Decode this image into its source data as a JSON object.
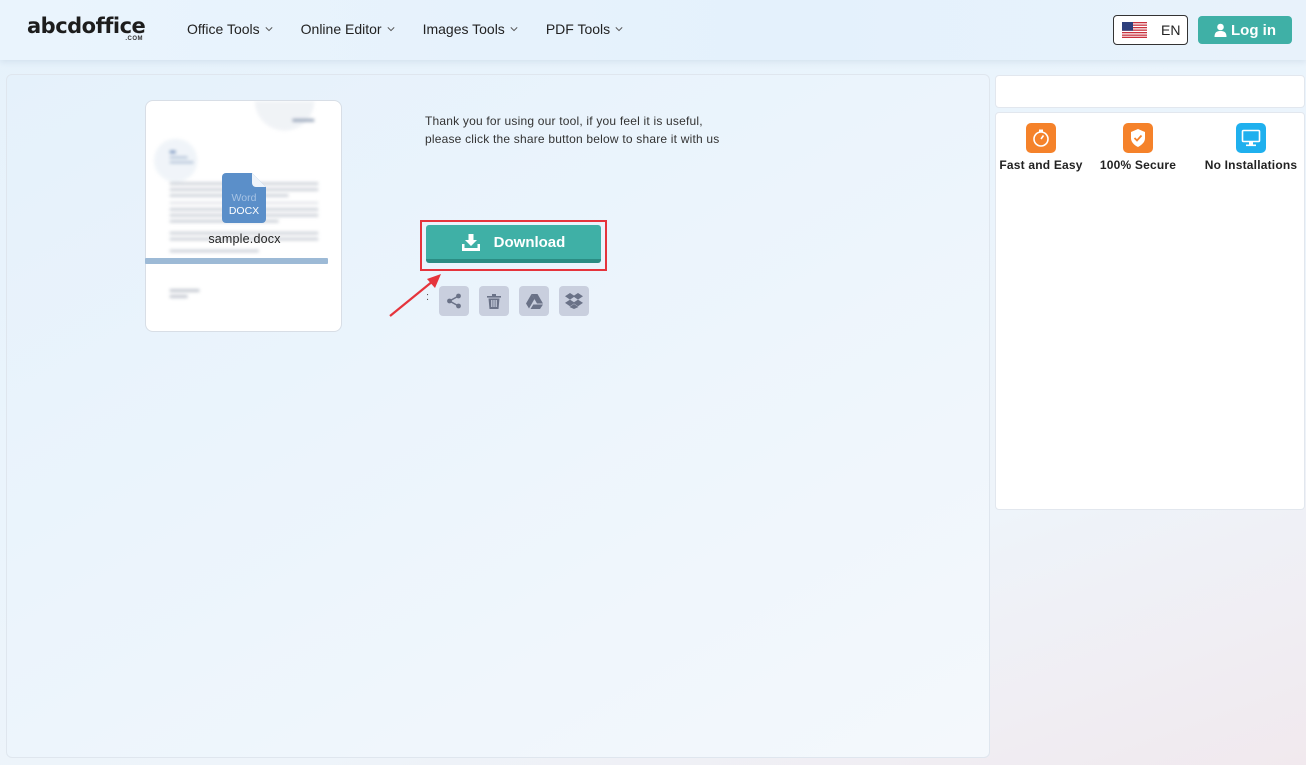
{
  "header": {
    "logo_text": "abcdoffice",
    "logo_sub": ".COM",
    "nav": [
      {
        "label": "Office Tools",
        "icon": "chevron-down-icon"
      },
      {
        "label": "Online Editor",
        "icon": "chevron-down-icon"
      },
      {
        "label": "Images Tools",
        "icon": "chevron-down-icon"
      },
      {
        "label": "PDF Tools",
        "icon": "chevron-down-icon"
      }
    ],
    "language": {
      "label": "EN",
      "icon": "us-flag-icon"
    },
    "login_label": "Log in"
  },
  "result": {
    "file_name": "sample.docx",
    "file_type_word": "Word",
    "file_type_ext": "DOCX",
    "thanks_line1": "Thank you for using our tool, if you feel it is useful,",
    "thanks_line2": "please click the share button below to share it with us",
    "download_label": "Download",
    "share_separator": ":",
    "actions": [
      {
        "name": "share",
        "icon": "share-icon"
      },
      {
        "name": "delete",
        "icon": "trash-icon"
      },
      {
        "name": "google-drive",
        "icon": "google-drive-icon"
      },
      {
        "name": "dropbox",
        "icon": "dropbox-icon"
      }
    ]
  },
  "features": [
    {
      "label": "Fast and Easy",
      "icon": "stopwatch-icon",
      "color": "#f5822a"
    },
    {
      "label": "100% Secure",
      "icon": "shield-check-icon",
      "color": "#f5822a"
    },
    {
      "label": "No Installations",
      "icon": "monitor-icon",
      "color": "#1fb0ee"
    }
  ],
  "colors": {
    "accent": "#3fb0a6",
    "highlight_frame": "#e5343c",
    "action_button_bg": "#c9cfde"
  }
}
